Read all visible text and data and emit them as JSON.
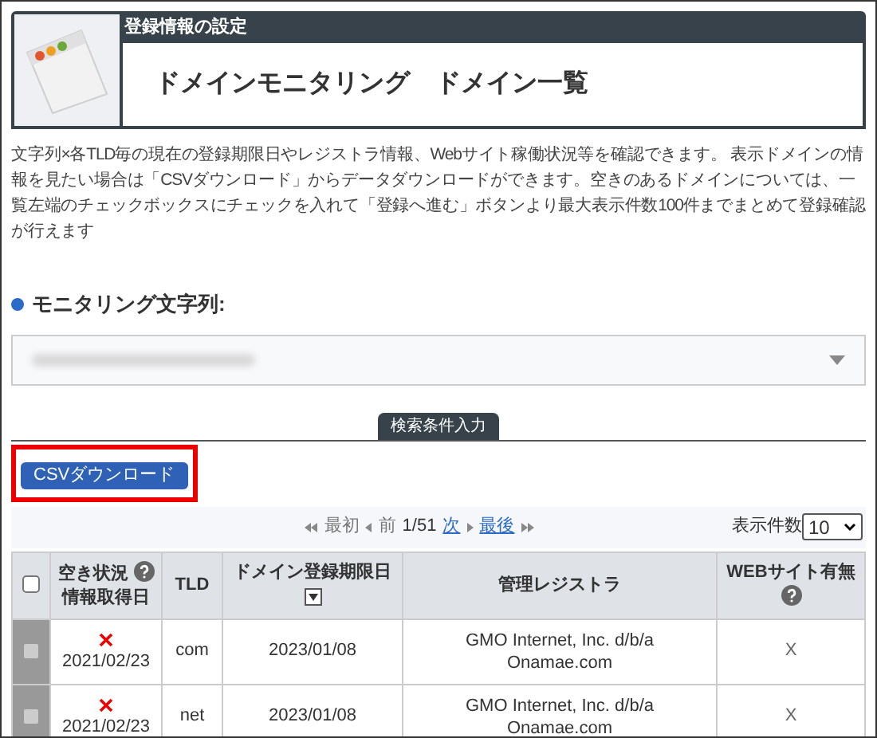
{
  "header": {
    "section_label": "登録情報の設定",
    "title": "ドメインモニタリング　ドメイン一覧"
  },
  "description": "文字列×各TLD毎の現在の登録期限日やレジストラ情報、Webサイト稼働状況等を確認できます。 表示ドメインの情報を見たい場合は「CSVダウンロード」からデータダウンロードができます。空きのあるドメインについては、一覧左端のチェックボックスにチェックを入れて「登録へ進む」ボタンより最大表示件数100件までまとめて登録確認が行えます",
  "monitoring_string": {
    "label": "モニタリング文字列:",
    "blurred": true
  },
  "search_tab": "検索条件入力",
  "csv_button": {
    "label": "CSVダウンロード",
    "highlighted": true
  },
  "pagination": {
    "first": {
      "label": "最初",
      "disabled": true
    },
    "prev": {
      "label": "前",
      "disabled": true
    },
    "page": "1/51",
    "next": {
      "label": "次",
      "disabled": false
    },
    "last": {
      "label": "最後",
      "disabled": false
    },
    "per_page_label": "表示件数",
    "per_page": "10"
  },
  "table": {
    "select_all_checked": false,
    "columns": [
      {
        "label": "空き状況",
        "sublabel": "情報取得日",
        "help": true,
        "sort": false
      },
      {
        "label": "TLD",
        "help": false,
        "sort": false
      },
      {
        "label": "ドメイン登録期限日",
        "help": false,
        "sort": true
      },
      {
        "label": "管理レジストラ",
        "help": false,
        "sort": false
      },
      {
        "label": "WEBサイト有無",
        "help": true,
        "sort": false
      }
    ],
    "rows": [
      {
        "checkbox_disabled": true,
        "available": false,
        "date": "2021/02/23",
        "tld": "com",
        "expiry": "2023/01/08",
        "registrar_lines": [
          "GMO Internet, Inc. d/b/a",
          "Onamae.com"
        ],
        "website": "X"
      },
      {
        "checkbox_disabled": true,
        "available": false,
        "date": "2021/02/23",
        "tld": "net",
        "expiry": "2023/01/08",
        "registrar_lines": [
          "GMO Internet, Inc. d/b/a",
          "Onamae.com"
        ],
        "website": "X"
      }
    ]
  }
}
